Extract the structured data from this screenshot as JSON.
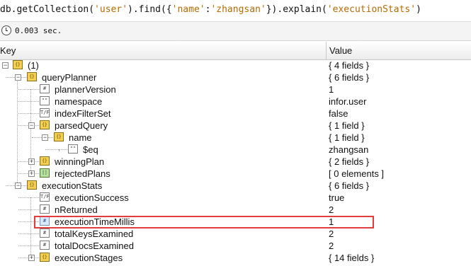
{
  "query": {
    "prefix": "db.getCollection(",
    "collection": "'user'",
    "find_open": ").find({",
    "field": "'name'",
    "colon": ":",
    "field_value": "'zhangsan'",
    "explain_open": "}).explain(",
    "explain_arg": "'executionStats'",
    "close": ")"
  },
  "status": {
    "time": "0.003 sec."
  },
  "table": {
    "key_header": "Key",
    "value_header": "Value",
    "rows": [
      {
        "label": "(1)",
        "value": "{ 4 fields }",
        "icon": "object-icon",
        "expander": "−"
      },
      {
        "label": "queryPlanner",
        "value": "{ 6 fields }",
        "icon": "object-icon",
        "expander": "−"
      },
      {
        "label": "plannerVersion",
        "value": "1",
        "icon": "number-icon",
        "expander": ""
      },
      {
        "label": "namespace",
        "value": "infor.user",
        "icon": "string-icon",
        "expander": ""
      },
      {
        "label": "indexFilterSet",
        "value": "false",
        "icon": "boolean-icon",
        "expander": ""
      },
      {
        "label": "parsedQuery",
        "value": "{ 1 field }",
        "icon": "object-icon",
        "expander": "−"
      },
      {
        "label": "name",
        "value": "{ 1 field }",
        "icon": "object-icon",
        "expander": "−"
      },
      {
        "label": "$eq",
        "value": "zhangsan",
        "icon": "string-icon",
        "expander": ""
      },
      {
        "label": "winningPlan",
        "value": "{ 2 fields }",
        "icon": "object-icon",
        "expander": "+"
      },
      {
        "label": "rejectedPlans",
        "value": "[ 0 elements ]",
        "icon": "array-icon",
        "expander": "+"
      },
      {
        "label": "executionStats",
        "value": "{ 6 fields }",
        "icon": "object-icon",
        "expander": "−"
      },
      {
        "label": "executionSuccess",
        "value": "true",
        "icon": "boolean-icon",
        "expander": ""
      },
      {
        "label": "nReturned",
        "value": "2",
        "icon": "number-icon",
        "expander": ""
      },
      {
        "label": "executionTimeMillis",
        "value": "1",
        "icon": "number-icon",
        "expander": ""
      },
      {
        "label": "totalKeysExamined",
        "value": "2",
        "icon": "number-icon",
        "expander": ""
      },
      {
        "label": "totalDocsExamined",
        "value": "2",
        "icon": "number-icon",
        "expander": ""
      },
      {
        "label": "executionStages",
        "value": "{ 14 fields }",
        "icon": "object-icon",
        "expander": "+"
      }
    ]
  },
  "icon_glyphs": {
    "object": "{}",
    "array": "[]",
    "number": "#",
    "string": "\"\"",
    "boolean": "T/F"
  },
  "colors": {
    "highlight": "#e23c3c",
    "string_literal": "#b86a00",
    "object_icon": "#f2cf52",
    "array_icon": "#b9e0a3"
  }
}
